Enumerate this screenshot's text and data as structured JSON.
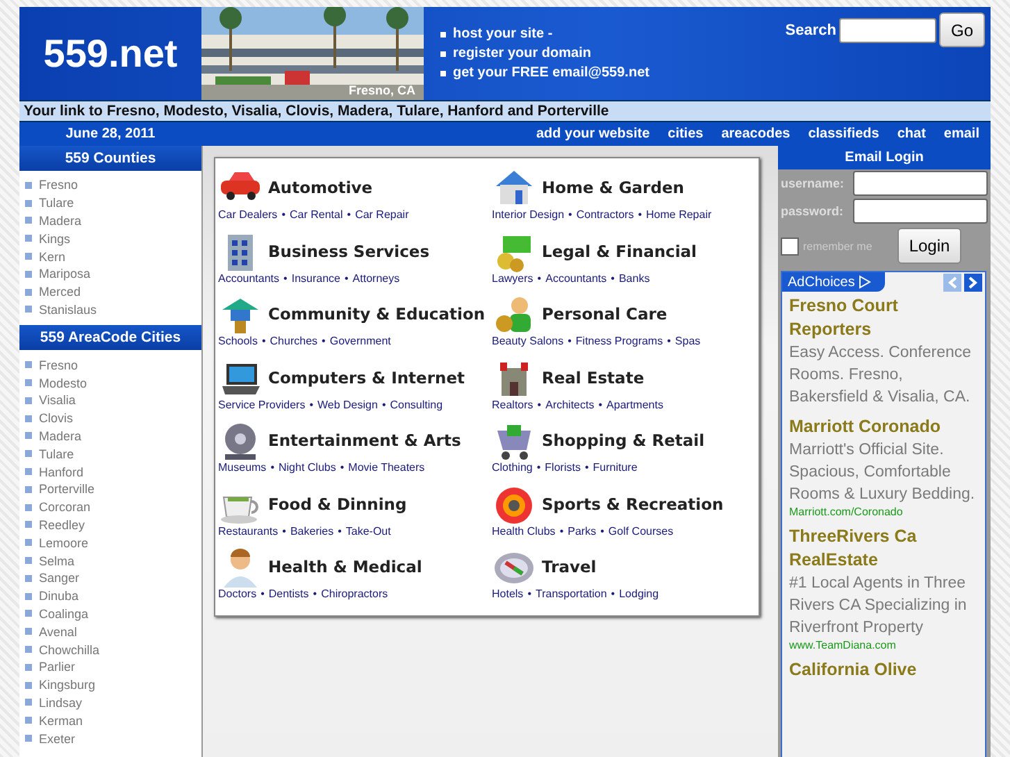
{
  "header": {
    "logo": "559.net",
    "photo_caption": "Fresno, CA",
    "promo": [
      "host your site -",
      "register your domain",
      "get your FREE email@559.net"
    ],
    "search_label": "Search",
    "search_button": "Go"
  },
  "tagline": "Your link to Fresno, Modesto, Visalia, Clovis, Madera, Tulare, Hanford and Porterville",
  "nav": {
    "date": "June 28, 2011",
    "links": [
      "add your website",
      "cities",
      "areacodes",
      "classifieds",
      "chat",
      "email"
    ]
  },
  "counties": {
    "title": "559 Counties",
    "items": [
      "Fresno",
      "Tulare",
      "Madera",
      "Kings",
      "Kern",
      "Mariposa",
      "Merced",
      "Stanislaus"
    ]
  },
  "cities": {
    "title": "559 AreaCode Cities",
    "items": [
      "Fresno",
      "Modesto",
      "Visalia",
      "Clovis",
      "Madera",
      "Tulare",
      "Hanford",
      "Porterville",
      "Corcoran",
      "Reedley",
      "Lemoore",
      "Selma",
      "Sanger",
      "Dinuba",
      "Coalinga",
      "Avenal",
      "Chowchilla",
      "Parlier",
      "Kingsburg",
      "Lindsay",
      "Kerman",
      "Exeter"
    ]
  },
  "categories": [
    {
      "title": "Automotive",
      "links": [
        "Car Dealers",
        "Car Rental",
        "Car Repair"
      ]
    },
    {
      "title": "Home & Garden",
      "links": [
        "Interior Design",
        "Contractors",
        "Home Repair"
      ]
    },
    {
      "title": "Business Services",
      "links": [
        "Accountants",
        "Insurance",
        "Attorneys"
      ]
    },
    {
      "title": "Legal & Financial",
      "links": [
        "Lawyers",
        "Accountants",
        "Banks"
      ]
    },
    {
      "title": "Community & Education",
      "links": [
        "Schools",
        "Churches",
        "Government"
      ]
    },
    {
      "title": "Personal Care",
      "links": [
        "Beauty Salons",
        "Fitness Programs",
        "Spas"
      ]
    },
    {
      "title": "Computers & Internet",
      "links": [
        "Service Providers",
        "Web Design",
        "Consulting"
      ]
    },
    {
      "title": "Real Estate",
      "links": [
        "Realtors",
        "Architects",
        "Apartments"
      ]
    },
    {
      "title": "Entertainment & Arts",
      "links": [
        "Museums",
        "Night Clubs",
        "Movie Theaters"
      ]
    },
    {
      "title": "Shopping & Retail",
      "links": [
        "Clothing",
        "Florists",
        "Furniture"
      ]
    },
    {
      "title": "Food & Dinning",
      "links": [
        "Restaurants",
        "Bakeries",
        "Take-Out"
      ]
    },
    {
      "title": "Sports & Recreation",
      "links": [
        "Health Clubs",
        "Parks",
        "Golf Courses"
      ]
    },
    {
      "title": "Health & Medical",
      "links": [
        "Doctors",
        "Dentists",
        "Chiropractors"
      ]
    },
    {
      "title": "Travel",
      "links": [
        "Hotels",
        "Transportation",
        "Lodging"
      ]
    }
  ],
  "separator": "•",
  "login": {
    "title": "Email Login",
    "username_label": "username:",
    "password_label": "password:",
    "remember_label": "remember me",
    "remember_checked": false,
    "button": "Login"
  },
  "ads": {
    "label": "AdChoices",
    "items": [
      {
        "title": "Fresno Court Reporters",
        "text": "Easy Access. Conference Rooms. Fresno, Bakersfield & Visalia, CA."
      },
      {
        "title": "Marriott Coronado",
        "text": "Marriott's Official Site. Spacious, Comfortable Rooms & Luxury Bedding.",
        "url": "Marriott.com/Coronado"
      },
      {
        "title": "ThreeRivers Ca RealEstate",
        "text": "#1 Local Agents in Three Rivers CA Specializing in Riverfront Property",
        "url": "www.TeamDiana.com"
      },
      {
        "title": "California Olive"
      }
    ]
  }
}
